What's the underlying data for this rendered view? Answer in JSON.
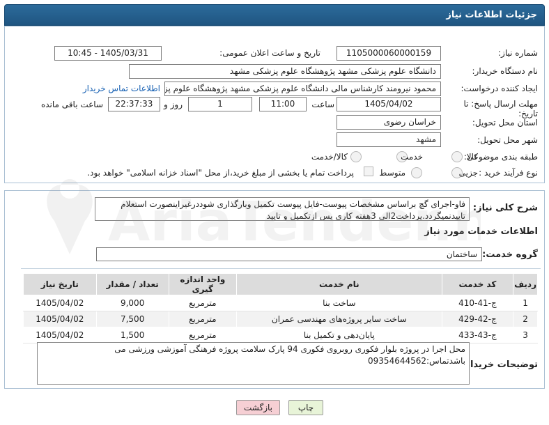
{
  "header": {
    "title": "جزئیات اطلاعات نیاز"
  },
  "form": {
    "need_number_label": "شماره نیاز:",
    "need_number": "1105000060000159",
    "announce_datetime_label": "تاریخ و ساعت اعلان عمومی:",
    "announce_datetime": "1405/03/31 - 10:45",
    "buyer_org_label": "نام دستگاه خریدار:",
    "buyer_org": "دانشگاه علوم پزشکی مشهد   پژوهشگاه علوم پزشکی مشهد",
    "requester_label": "ایجاد کننده درخواست:",
    "requester": "محمود نیرومند کارشناس مالی دانشگاه علوم پزشکی مشهد   پژوهشگاه علوم پزشکی مشهد",
    "buyer_contact_link": "اطلاعات تماس خریدار",
    "deadline_label_1": "مهلت ارسال پاسخ: تا",
    "deadline_label_2": "تاریخ:",
    "deadline_date": "1405/04/02",
    "time_label": "ساعت",
    "deadline_time": "11:00",
    "days_value": "1",
    "days_label": "روز و",
    "remaining_time": "22:37:33",
    "remaining_label": "ساعت باقی مانده",
    "province_label": "استان محل تحویل:",
    "province": "خراسان رضوی",
    "city_label": "شهر محل تحویل:",
    "city": "مشهد",
    "category_label": "طبقه بندی موضوعی:",
    "category_options": [
      "کالا",
      "خدمت",
      "کالا/خدمت"
    ],
    "purchase_type_label": "نوع فرآیند خرید :",
    "purchase_type_options": [
      "جزیی",
      "متوسط"
    ],
    "payment_note": "پرداخت تمام یا بخشی از مبلغ خرید،از محل \"اسناد خزانه اسلامی\" خواهد بود."
  },
  "summary": {
    "label": "شرح کلی نیاز:",
    "text": "فاو-اجرای گچ براساس مشخصات پیوست-فایل پیوست تکمیل وبارگذاری شوددرغیراینصورت استعلام تاییدنمیگردد.پرداخت2الی 3هفته کاری پس ازتکمیل و تایید"
  },
  "services_section": {
    "title": "اطلاعات خدمات مورد نیاز",
    "group_label": "گروه خدمت:",
    "group_value": "ساختمان"
  },
  "table": {
    "headers": [
      "ردیف",
      "کد خدمت",
      "نام خدمت",
      "واحد اندازه گیری",
      "تعداد / مقدار",
      "تاریخ نیاز"
    ],
    "rows": [
      {
        "index": "1",
        "code": "ج-41-410",
        "name": "ساخت بنا",
        "unit": "مترمربع",
        "qty": "9,000",
        "date": "1405/04/02"
      },
      {
        "index": "2",
        "code": "ج-42-429",
        "name": "ساخت سایر پروژه‌های مهندسی عمران",
        "unit": "مترمربع",
        "qty": "7,500",
        "date": "1405/04/02"
      },
      {
        "index": "3",
        "code": "ج-43-433",
        "name": "پایان‌دهی و تکمیل بنا",
        "unit": "مترمربع",
        "qty": "1,500",
        "date": "1405/04/02"
      }
    ]
  },
  "buyer_notes": {
    "label": "توضیحات خریدار:",
    "line1": "محل اجرا در پروژه بلوار فکوری روبروی فکوری 94 پارک سلامت پروژه فرهنگی آموزشی ورزشی می",
    "line2": "باشدتماس:09354644562"
  },
  "buttons": {
    "print": "چاپ",
    "back": "بازگشت"
  },
  "watermark": {
    "text": "AriaTender.net"
  },
  "colors": {
    "header": "#1f5581",
    "link": "#1660b3",
    "back_button": "#f6cfd4",
    "print_button": "#e8f4d8"
  }
}
